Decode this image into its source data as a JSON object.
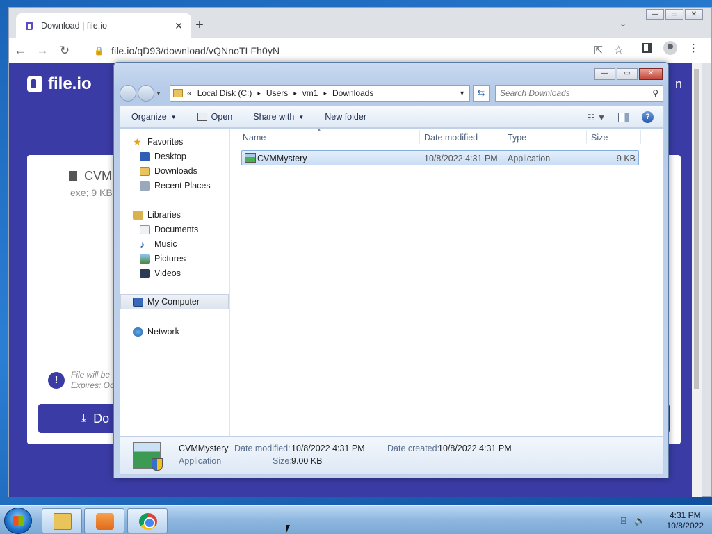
{
  "browser": {
    "tab_title": "Download | file.io",
    "tab_close": "✕",
    "new_tab": "+",
    "url": "file.io/qD93/download/vQNnoTLFh0yN",
    "win_min": "—",
    "win_max": "▭",
    "win_close": "✕"
  },
  "page": {
    "brand": "file.io",
    "header_right": "n",
    "file_name": "CVM",
    "file_meta": "exe; 9 KB",
    "notice_line1": "File will be",
    "notice_line2": "Expires: Oc",
    "notice_icon": "!",
    "download_label": "Do"
  },
  "explorer": {
    "address": {
      "prefix": "«",
      "segments": [
        "Local Disk (C:)",
        "Users",
        "vm1",
        "Downloads"
      ],
      "sep": "▸"
    },
    "search_placeholder": "Search Downloads",
    "commands": {
      "organize": "Organize",
      "open": "Open",
      "share_with": "Share with",
      "new_folder": "New folder",
      "help": "?"
    },
    "nav": {
      "favorites": "Favorites",
      "desktop": "Desktop",
      "downloads": "Downloads",
      "recent_places": "Recent Places",
      "libraries": "Libraries",
      "documents": "Documents",
      "music": "Music",
      "pictures": "Pictures",
      "videos": "Videos",
      "my_computer": "My Computer",
      "network": "Network"
    },
    "columns": {
      "name": "Name",
      "date_modified": "Date modified",
      "type": "Type",
      "size": "Size"
    },
    "file": {
      "name": "CVMMystery",
      "date_modified": "10/8/2022 4:31 PM",
      "type": "Application",
      "size": "9 KB"
    },
    "details": {
      "name": "CVMMystery",
      "kind": "Application",
      "date_modified_label": "Date modified:",
      "date_modified": "10/8/2022 4:31 PM",
      "size_label": "Size:",
      "size": "9.00 KB",
      "date_created_label": "Date created:",
      "date_created": "10/8/2022 4:31 PM"
    }
  },
  "taskbar": {
    "time": "4:31 PM",
    "date": "10/8/2022"
  }
}
